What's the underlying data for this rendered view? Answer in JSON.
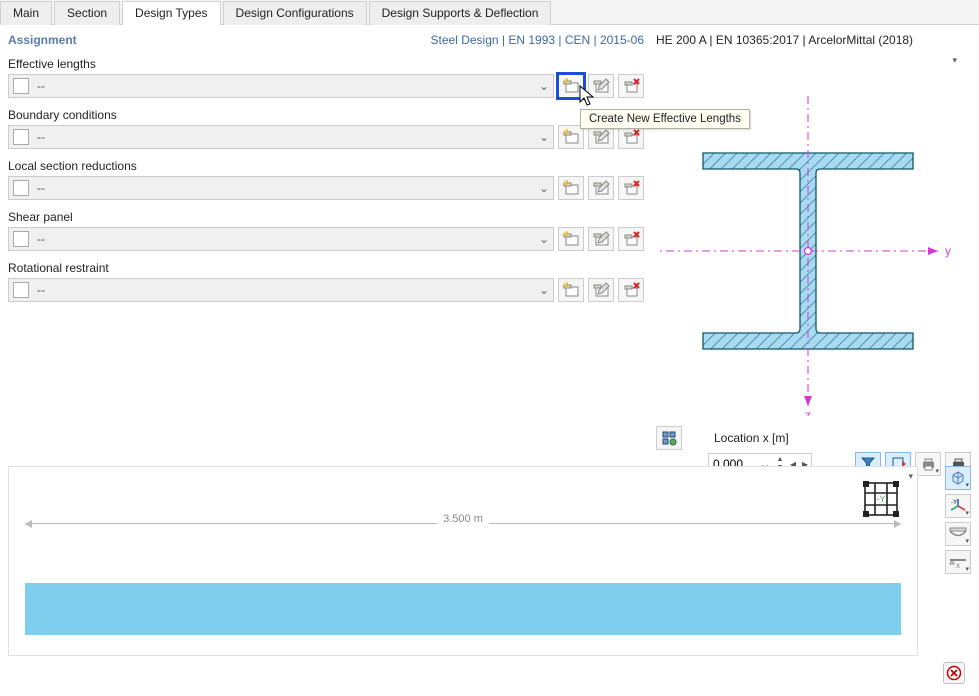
{
  "tabs": [
    {
      "id": "main",
      "label": "Main",
      "active": false
    },
    {
      "id": "section",
      "label": "Section",
      "active": false
    },
    {
      "id": "design-types",
      "label": "Design Types",
      "active": true
    },
    {
      "id": "design-config",
      "label": "Design Configurations",
      "active": false
    },
    {
      "id": "design-supports",
      "label": "Design Supports & Deflection",
      "active": false
    }
  ],
  "panel": {
    "title": "Assignment",
    "design_info": "Steel Design | EN 1993 | CEN | 2015-06"
  },
  "fields": [
    {
      "id": "effective-lengths",
      "label": "Effective lengths",
      "value": "--",
      "highlight_new": true
    },
    {
      "id": "boundary-conditions",
      "label": "Boundary conditions",
      "value": "--",
      "highlight_new": false
    },
    {
      "id": "local-section-reductions",
      "label": "Local section reductions",
      "value": "--",
      "highlight_new": false
    },
    {
      "id": "shear-panel",
      "label": "Shear panel",
      "value": "--",
      "highlight_new": false
    },
    {
      "id": "rotational-restraint",
      "label": "Rotational restraint",
      "value": "--",
      "highlight_new": false
    }
  ],
  "tooltip": "Create New Effective Lengths",
  "section": {
    "header": "HE 200 A | EN 10365:2017 | ArcelorMittal (2018)",
    "axis_y": "y",
    "axis_z": "z",
    "location_label": "Location x [m]",
    "location_value": "0.000"
  },
  "beam": {
    "length_label": "3.500 m"
  },
  "icons": {
    "star_folder": "new",
    "edit": "edit",
    "delete_red": "delete"
  },
  "colors": {
    "accent": "#1a4fd8",
    "section_fill": "#a9dbf0",
    "section_hatch": "#4b8fb8",
    "axis": "#d63ad6"
  }
}
